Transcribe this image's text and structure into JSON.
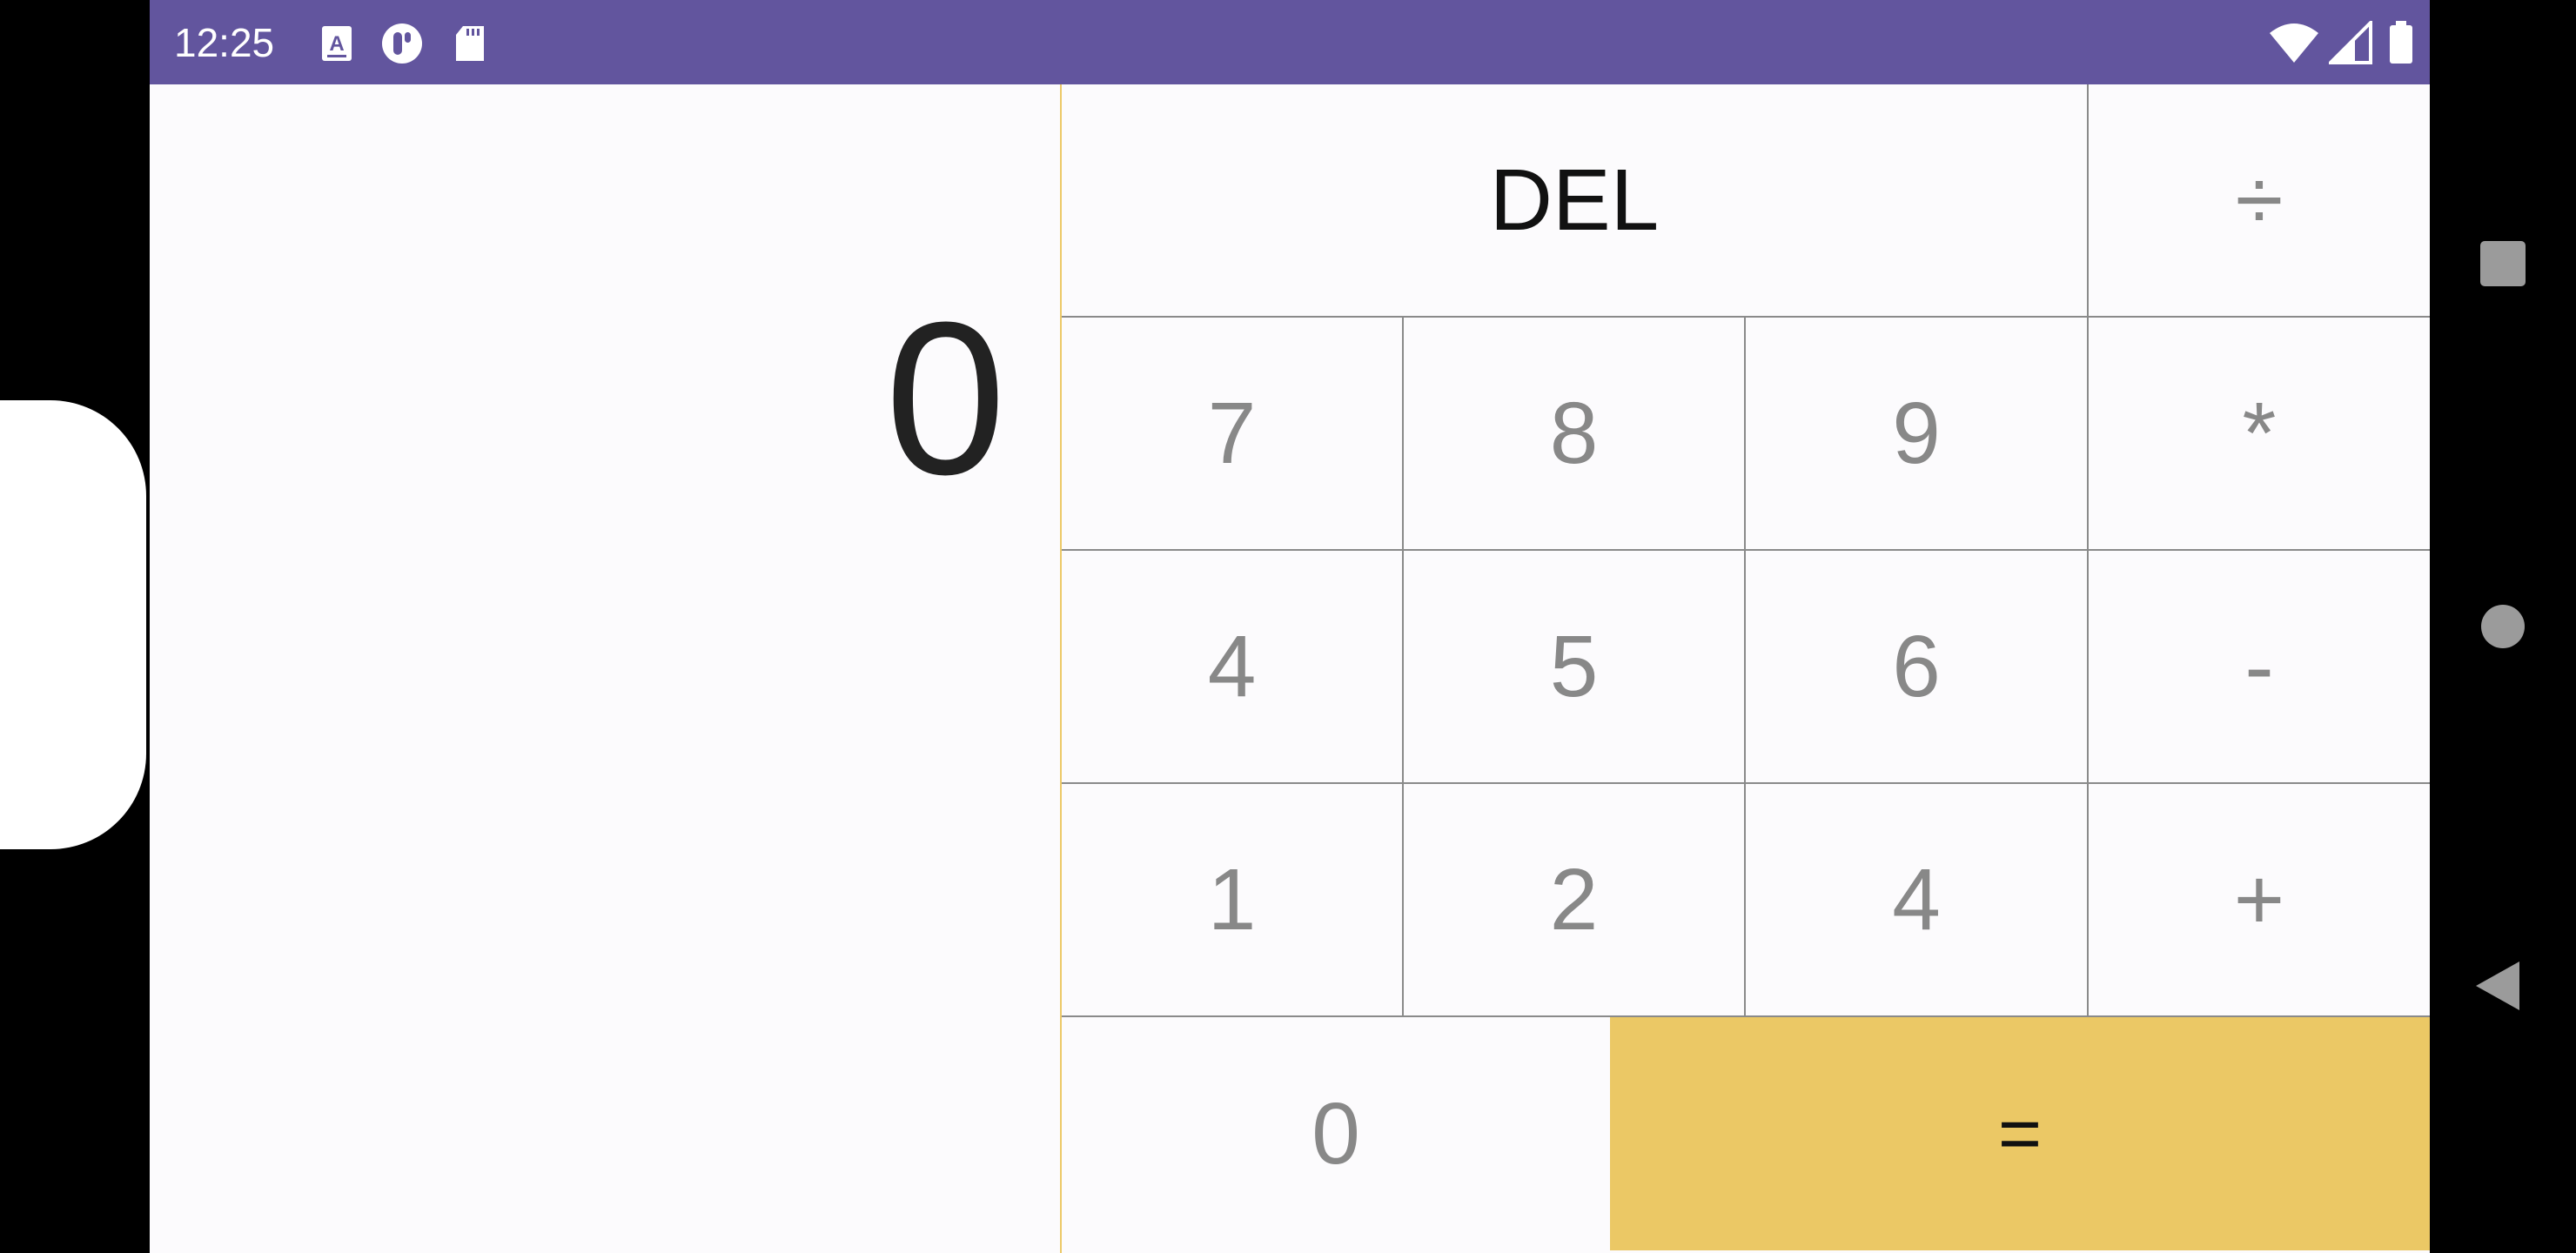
{
  "status_bar": {
    "time": "12:25",
    "icons_left": [
      "keyboard-a-icon",
      "app-notification-icon",
      "sd-card-icon"
    ],
    "icons_right": [
      "wifi-icon",
      "cell-signal-icon",
      "battery-icon"
    ],
    "color": "#62559e"
  },
  "display": {
    "value": "0"
  },
  "keypad": {
    "del_label": "DEL",
    "divide_label": "÷",
    "multiply_label": "*",
    "minus_label": "-",
    "plus_label": "+",
    "equals_label": "=",
    "row1": [
      "7",
      "8",
      "9"
    ],
    "row2": [
      "4",
      "5",
      "6"
    ],
    "row3": [
      "1",
      "2",
      "4"
    ],
    "zero_label": "0"
  },
  "colors": {
    "accent": "#ebc865",
    "key_text": "#888888",
    "divider": "#8a8a8a"
  },
  "nav_bar": {
    "buttons": [
      "recents-square-icon",
      "home-circle-icon",
      "back-triangle-icon"
    ]
  }
}
